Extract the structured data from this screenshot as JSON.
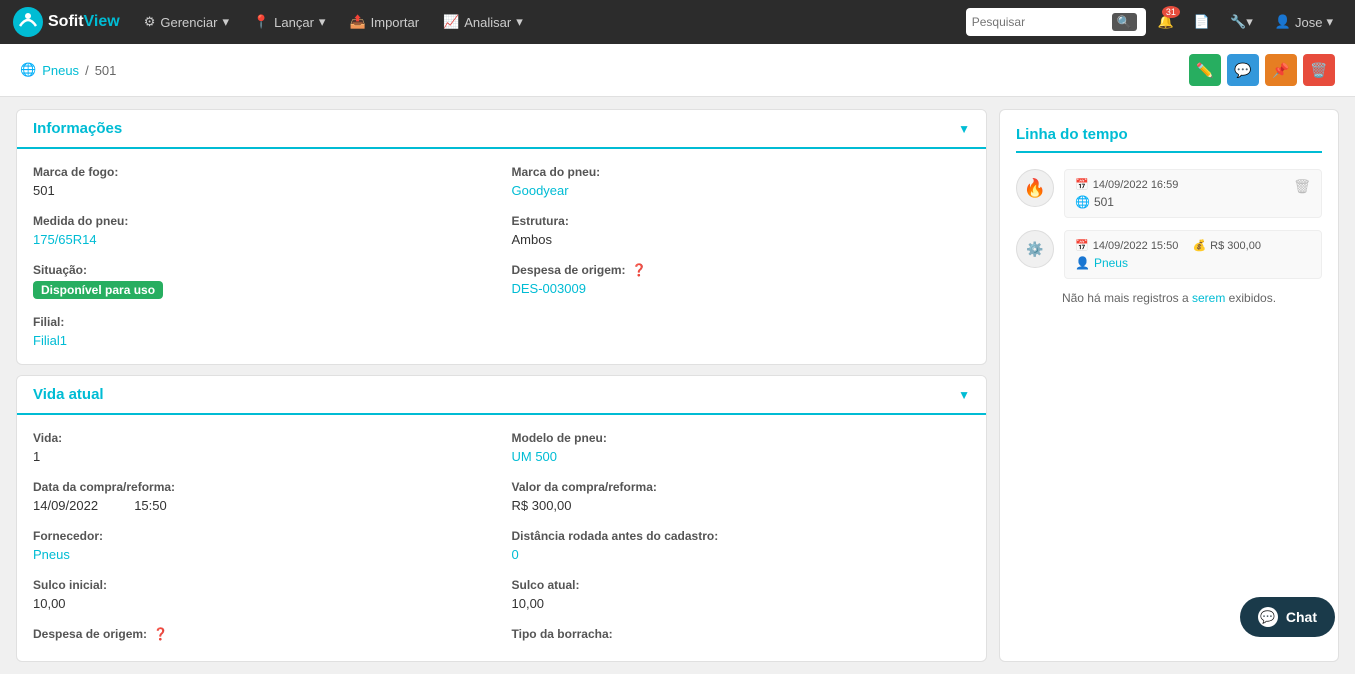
{
  "brand": {
    "sofit": "Sofit",
    "view": "View"
  },
  "navbar": {
    "items": [
      {
        "label": "Gerenciar",
        "icon": "gear"
      },
      {
        "label": "Lançar",
        "icon": "location"
      },
      {
        "label": "Importar",
        "icon": "upload"
      },
      {
        "label": "Analisar",
        "icon": "chart"
      }
    ],
    "search_placeholder": "Pesquisar",
    "notification_count": "31",
    "user_label": "Jose"
  },
  "breadcrumb": {
    "parent_label": "Pneus",
    "separator": "/",
    "current": "501"
  },
  "action_buttons": {
    "edit_title": "Editar",
    "chat_title": "Chat",
    "pin_title": "Fixar",
    "delete_title": "Excluir"
  },
  "informacoes": {
    "section_title": "Informações",
    "fields": [
      {
        "label": "Marca de fogo:",
        "value": "501",
        "type": "text"
      },
      {
        "label": "Marca do pneu:",
        "value": "Goodyear",
        "type": "link"
      },
      {
        "label": "Medida do pneu:",
        "value": "175/65R14",
        "type": "link"
      },
      {
        "label": "Estrutura:",
        "value": "Ambos",
        "type": "text"
      },
      {
        "label": "Situação:",
        "value": "Disponível para uso",
        "type": "badge"
      },
      {
        "label": "Despesa de origem:",
        "value": "DES-003009",
        "type": "link",
        "has_help": true
      },
      {
        "label": "Filial:",
        "value": "Filial1",
        "type": "link"
      }
    ]
  },
  "vida_atual": {
    "section_title": "Vida atual",
    "fields": [
      {
        "label": "Vida:",
        "value": "1",
        "type": "text",
        "col": "left"
      },
      {
        "label": "Modelo de pneu:",
        "value": "UM 500",
        "type": "link",
        "col": "right"
      },
      {
        "label": "Data da compra/reforma:",
        "value": "14/09/2022",
        "time": "15:50",
        "type": "datetime",
        "col": "left"
      },
      {
        "label": "Valor da compra/reforma:",
        "value": "R$ 300,00",
        "type": "text",
        "col": "right"
      },
      {
        "label": "Fornecedor:",
        "value": "Pneus",
        "type": "link",
        "col": "left"
      },
      {
        "label": "Distância rodada antes do cadastro:",
        "value": "0",
        "type": "link",
        "col": "right"
      },
      {
        "label": "Sulco inicial:",
        "value": "10,00",
        "type": "text",
        "col": "left"
      },
      {
        "label": "Sulco atual:",
        "value": "10,00",
        "type": "text",
        "col": "right"
      },
      {
        "label": "Despesa de origem:",
        "value": "",
        "type": "text",
        "col": "left",
        "has_help": true
      },
      {
        "label": "Tipo da borracha:",
        "value": "",
        "type": "text",
        "col": "right"
      }
    ]
  },
  "timeline": {
    "title": "Linha do tempo",
    "items": [
      {
        "icon": "🔥",
        "date": "14/09/2022 16:59",
        "ref": "501",
        "ref_type": "text",
        "has_delete": true
      },
      {
        "icon": "⚙️",
        "date": "14/09/2022 15:50",
        "value": "R$ 300,00",
        "ref": "Pneus",
        "ref_type": "link",
        "has_delete": false
      }
    ],
    "no_more_text": "Não há mais registros a serem exibidos.",
    "serem_link": "serem"
  },
  "chat": {
    "label": "Chat"
  }
}
